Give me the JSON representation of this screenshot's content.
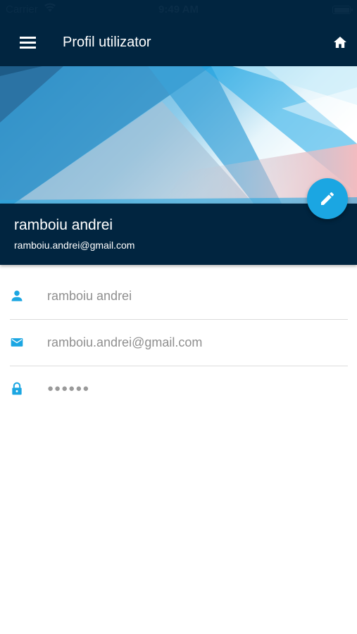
{
  "status_bar": {
    "carrier": "Carrier",
    "time": "9:49 AM",
    "wifi_icon": "wifi-icon",
    "battery_icon": "battery-icon"
  },
  "app_bar": {
    "title": "Profil utilizator",
    "menu_icon": "menu-icon",
    "home_icon": "home-icon",
    "background_color": "#012540"
  },
  "profile": {
    "name": "ramboiu andrei",
    "email": "ramboiu.andrei@gmail.com",
    "edit_icon": "pencil-icon",
    "accent_color": "#1ba6e2"
  },
  "fields": [
    {
      "icon": "person-icon",
      "value": "ramboiu andrei"
    },
    {
      "icon": "email-icon",
      "value": "ramboiu.andrei@gmail.com"
    },
    {
      "icon": "lock-icon",
      "value": "●●●●●●"
    }
  ]
}
